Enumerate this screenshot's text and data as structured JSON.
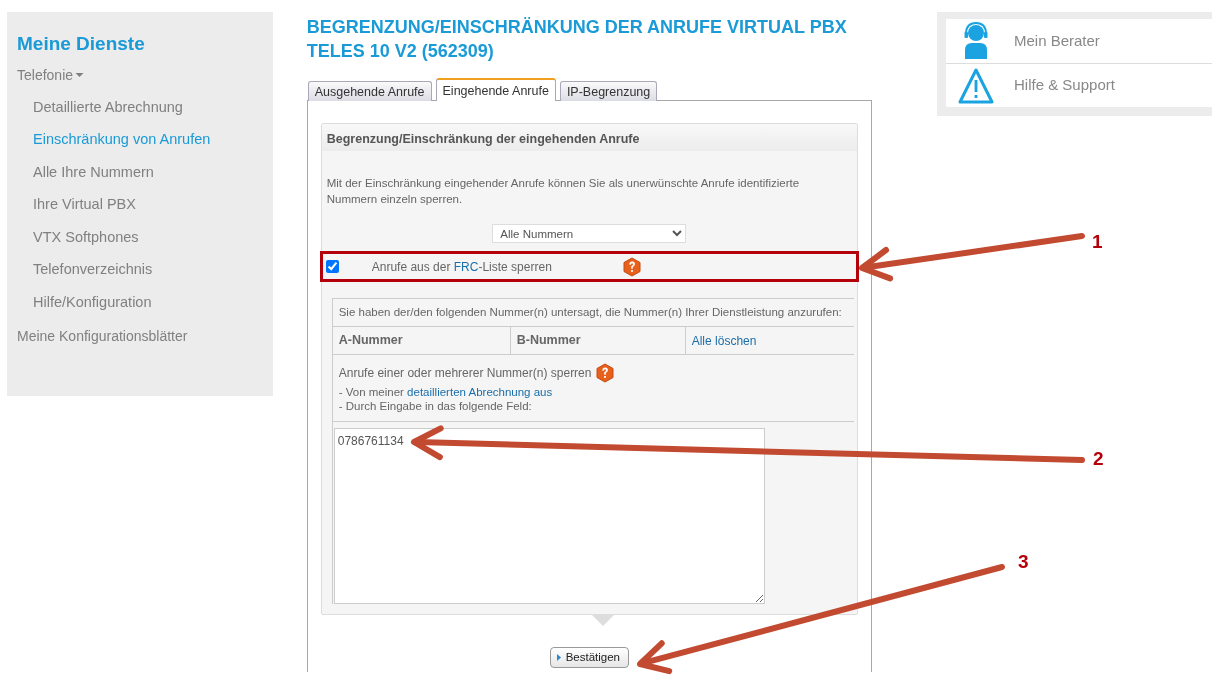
{
  "sidebar": {
    "title": "Meine Dienste",
    "items": [
      {
        "label": "Telefonie",
        "expanded": true,
        "selected": false,
        "children": [
          {
            "label": "Detaillierte Abrechnung",
            "selected": false
          },
          {
            "label": "Einschränkung von Anrufen",
            "selected": true
          },
          {
            "label": "Alle Ihre Nummern",
            "selected": false
          },
          {
            "label": "Ihre Virtual PBX",
            "selected": false
          },
          {
            "label": "VTX Softphones",
            "selected": false
          },
          {
            "label": "Telefonverzeichnis",
            "selected": false
          },
          {
            "label": "Hilfe/Konfiguration",
            "selected": false
          }
        ]
      },
      {
        "label": "Meine Konfigurationsblätter",
        "expanded": false,
        "selected": false
      }
    ]
  },
  "page_title": "BEGRENZUNG/EINSCHRÄNKUNG DER ANRUFE VIRTUAL PBX TELES 10 V2 (562309)",
  "tabs": [
    {
      "label": "Ausgehende Anrufe",
      "selected": false
    },
    {
      "label": "Eingehende Anrufe",
      "selected": true
    },
    {
      "label": "IP-Begrenzung",
      "selected": false
    }
  ],
  "panel": {
    "title": "Begrenzung/Einschränkung der eingehenden Anrufe",
    "intro": "Mit der Einschränkung eingehender Anrufe können Sie als unerwünschte Anrufe identifizierte Nummern einzeln sperren.",
    "select": {
      "value": "Alle Nummern"
    },
    "frc": {
      "checked": true,
      "parts": [
        {
          "kind": "text",
          "text": "Anrufe aus der "
        },
        {
          "kind": "link",
          "text": "FRC"
        },
        {
          "kind": "text",
          "text": "-Liste sperren"
        }
      ]
    },
    "blocked": {
      "intro": "Sie haben der/den folgenden Nummer(n) untersagt, die Nummer(n) Ihrer Dienstleistung anzurufen:",
      "columns": [
        "A-Nummer",
        "B-Nummer"
      ],
      "action": "Alle löschen"
    },
    "add": {
      "title": "Anrufe einer oder mehrerer Nummer(n) sperren",
      "lines": [
        [
          {
            "kind": "text",
            "text": "- Von meiner "
          },
          {
            "kind": "link",
            "text": "detaillierten Abrechnung aus"
          }
        ],
        [
          {
            "kind": "text",
            "text": "- Durch Eingabe in das folgende Feld:"
          }
        ]
      ]
    },
    "numbers": "0786761134",
    "button": "Bestätigen"
  },
  "help_links": [
    {
      "label": "Mein Berater"
    },
    {
      "label": "Hilfe & Support"
    }
  ],
  "annotations": [
    {
      "label": "1"
    },
    {
      "label": "2"
    },
    {
      "label": "3"
    }
  ]
}
